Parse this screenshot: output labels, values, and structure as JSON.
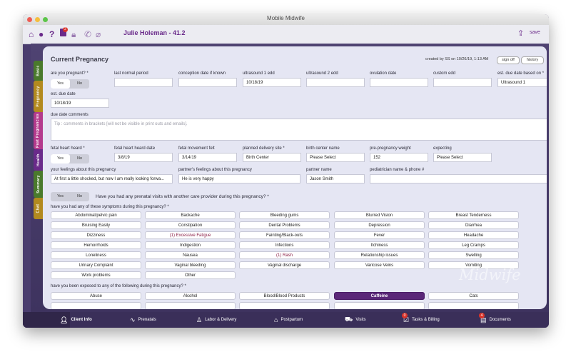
{
  "window": {
    "title": "Mobile Midwife"
  },
  "toolbar": {
    "patient": "Julie Holeman - 41.2",
    "save_label": "save",
    "icons": [
      "home-icon",
      "chat-icon",
      "help-icon",
      "flag-icon",
      "lock-icon",
      "phone-icon",
      "paperclip-icon"
    ],
    "badge_count": "2"
  },
  "side_tabs": [
    {
      "label": "Basic",
      "color": "#4a7a2c"
    },
    {
      "label": "Pregnancy",
      "color": "#b38a1f"
    },
    {
      "label": "Past Pregnancies",
      "color": "#b43a8c"
    },
    {
      "label": "Health",
      "color": "#6a2a8a"
    },
    {
      "label": "Summary",
      "color": "#4a7a2c"
    },
    {
      "label": "Chat",
      "color": "#b38a1f"
    }
  ],
  "form": {
    "title": "Current Pregnancy",
    "created": "created by SS on 10/26/19, 1:13 AM",
    "sign_off": "sign off",
    "history": "history",
    "are_pregnant": "are you pregnant? *",
    "yes": "Yes",
    "no": "No",
    "lnp": "last normal period",
    "conception": "conception date if known",
    "us1": "ultrasound 1 edd",
    "us1_val": "10/18/19",
    "us2": "ultrasound 2 edd",
    "ovulation": "ovulation date",
    "custom_edd": "custom edd",
    "edd_based": "est. due date based on *",
    "edd_based_val": "Ultrasound 1",
    "est_due": "est. due date",
    "est_due_val": "10/18/19",
    "due_comments": "due date comments",
    "due_comments_ph": "Tip : comments in brackets [will not be visible in print outs and emails].",
    "fhh": "fetal heart heard *",
    "fhh_date": "fetal heart heard date",
    "fhh_date_val": "3/8/19",
    "fmf": "fetal movement felt",
    "fmf_val": "3/14/19",
    "delivery": "planned delivery site *",
    "delivery_val": "Birth Center",
    "birth_center": "birth center name",
    "birth_center_val": "Please Select",
    "prepreg_weight": "pre-pregnancy weight",
    "prepreg_weight_val": "152",
    "expecting": "expecting",
    "expecting_val": "Please Select",
    "feelings": "your feelings about this pregnancy",
    "feelings_val": "At first a little shocked, but now I am really looking forwa...",
    "partner_feelings": "partner's feelings about this pregnancy",
    "partner_feelings_val": "He is very happy",
    "partner_name": "partner name",
    "partner_name_val": "Jason Smith",
    "pediatrician": "pediatrician name & phone #",
    "prenatal_q": "Have you had any prenatal visits with another care provider during this pregnancy? *",
    "symptoms_q": "have you had any of these symptoms during this pregnancy? *",
    "exposure_q": "have you been exposed to any of the following during this pregnancy? *"
  },
  "symptoms": [
    "Abdominal/pelvic pain",
    "Backache",
    "Bleeding gums",
    "Blurred Vision",
    "Breast Tenderness",
    "Bruising Easily",
    "Constipation",
    "Dental Problems",
    "Depression",
    "Diarrhea",
    "Dizziness",
    "(1) Excessive Fatigue",
    "Fainting/Black-outs",
    "Fever",
    "Headache",
    "Hemorrhoids",
    "Indigestion",
    "Infections",
    "Itchiness",
    "Leg Cramps",
    "Loneliness",
    "Nausea",
    "(1) Rash",
    "Relationship issues",
    "Swelling",
    "Urinary Complaint",
    "Vaginal bleeding",
    "Vaginal discharge",
    "Varicose Veins",
    "Vomiting",
    "Work problems",
    "Other"
  ],
  "flagged_symptoms": [
    "(1) Excessive Fatigue",
    "(1) Rash"
  ],
  "exposures": [
    "Abuse",
    "Alcohol",
    "Blood/Blood Products",
    "Caffeine",
    "Cats"
  ],
  "selected_exposure": "Caffeine",
  "bottom_tabs": [
    {
      "label": "Client Info",
      "icon": "person-icon"
    },
    {
      "label": "Prenatals",
      "icon": "heartbeat-icon"
    },
    {
      "label": "Labor & Delivery",
      "icon": "baby-icon"
    },
    {
      "label": "Postpartum",
      "icon": "home-icon"
    },
    {
      "label": "Visits",
      "icon": "car-icon"
    },
    {
      "label": "Tasks & Billing",
      "icon": "tasks-icon",
      "badge": "0"
    },
    {
      "label": "Documents",
      "icon": "document-icon",
      "badge": "4"
    }
  ],
  "colors": {
    "accent": "#6a2a8a",
    "frame": "#4a3d6e",
    "selected": "#5a2778",
    "flag_text": "#8b1d45"
  }
}
